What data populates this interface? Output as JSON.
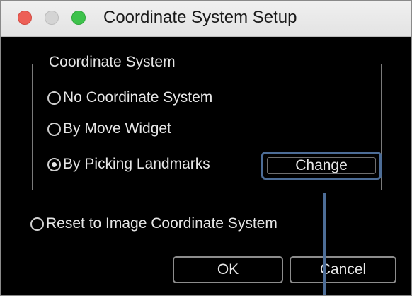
{
  "window": {
    "title": "Coordinate System Setup"
  },
  "group": {
    "title": "Coordinate System",
    "options": [
      {
        "label": "No Coordinate System",
        "checked": false
      },
      {
        "label": "By Move Widget",
        "checked": false
      },
      {
        "label": "By Picking Landmarks",
        "checked": true
      }
    ],
    "change_label": "Change"
  },
  "reset_option": {
    "label": "Reset to Image Coordinate System",
    "checked": false
  },
  "buttons": {
    "ok_label": "OK",
    "cancel_label": "Cancel"
  },
  "colors": {
    "dialog_background": "#000000",
    "titlebar": "#ececec",
    "highlight": "#4d6d97",
    "close": "#ed5f56",
    "maximize": "#3dc24b"
  }
}
